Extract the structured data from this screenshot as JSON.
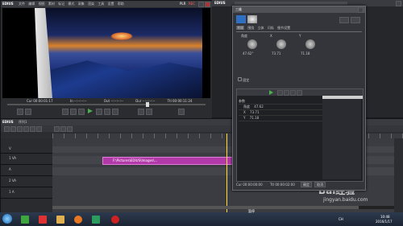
{
  "player": {
    "logo": "EDIUS",
    "menu": [
      "文件",
      "编辑",
      "视图",
      "素材",
      "标记",
      "模式",
      "采集",
      "渲染",
      "工具",
      "设置",
      "帮助"
    ],
    "mode_label": "PLR",
    "rec_label": "REC",
    "timecodes": {
      "cur": "Cur 00:00:01:17",
      "in": "In --:--:--:--",
      "out": "Out --:--:--:--",
      "dur": "Dur --:--:--:--",
      "ttl": "Ttl 00:00:11:24"
    }
  },
  "effect_panel": {
    "logo": "EDIUS",
    "title": "三维",
    "tabs": [
      "常规",
      "围绕",
      "立体",
      "闪烁",
      "细节设置"
    ],
    "knobs": [
      {
        "label": "角度",
        "value": "47.62°"
      },
      {
        "label": "X",
        "value": "73.71"
      },
      {
        "label": "Y",
        "value": "71.18"
      }
    ],
    "checkbox_label": "固定",
    "keyframe_rows": [
      {
        "name": "参数"
      },
      {
        "name": "角度",
        "value": "47.62"
      },
      {
        "name": "X",
        "value": "73.71"
      },
      {
        "name": "Y",
        "value": "71.18"
      }
    ],
    "timecode_left": "Cur 00:00:00:00",
    "timecode_right": "Ttl 00:00:02:00",
    "ok_label": "确定",
    "cancel_label": "取消"
  },
  "timeline": {
    "logo": "EDIUS",
    "sequence_name": "序列1",
    "tracks": [
      "V",
      "1 VA",
      "A",
      "2 VA",
      "1 A"
    ],
    "clip_label": "F:\\Pictures\\EDIUS\\Images\\..."
  },
  "taskbar": {
    "lang": "CH",
    "time": "10:48",
    "date": "2016/1/17",
    "watermark_text": "Bai经验",
    "watermark_url": "jingyan.baidu.com",
    "tray_text": "暂停"
  }
}
